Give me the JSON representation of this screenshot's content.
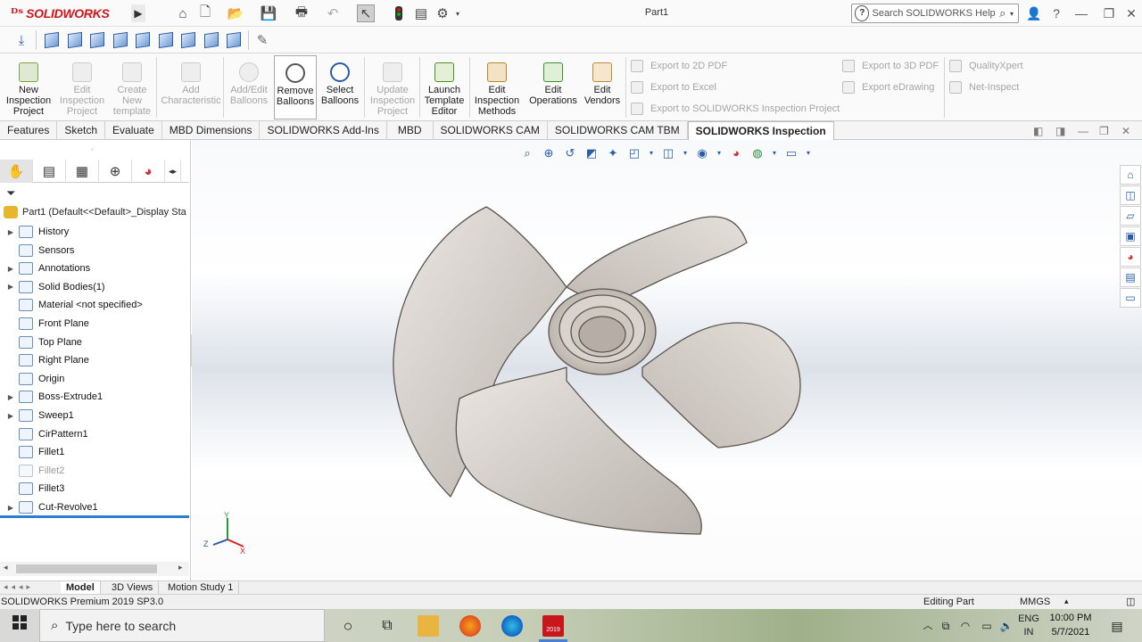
{
  "app": {
    "logo_text": "SOLIDWORKS",
    "doc_title": "Part1",
    "search_placeholder": "Search SOLIDWORKS Help"
  },
  "command_manager": {
    "buttons": [
      {
        "label": "New\nInspection\nProject",
        "enabled": true
      },
      {
        "label": "Edit\nInspection\nProject",
        "enabled": false
      },
      {
        "label": "Create\nNew\ntemplate",
        "enabled": false
      },
      {
        "label": "Add\nCharacteristic",
        "enabled": false
      },
      {
        "label": "Add/Edit\nBalloons",
        "enabled": false
      },
      {
        "label": "Remove\nBalloons",
        "enabled": true
      },
      {
        "label": "Select\nBalloons",
        "enabled": true
      },
      {
        "label": "Update\nInspection\nProject",
        "enabled": false
      },
      {
        "label": "Launch\nTemplate\nEditor",
        "enabled": true
      },
      {
        "label": "Edit\nInspection\nMethods",
        "enabled": true
      },
      {
        "label": "Edit\nOperations",
        "enabled": true
      },
      {
        "label": "Edit\nVendors",
        "enabled": true
      }
    ],
    "export": {
      "export_2d_pdf": "Export to 2D PDF",
      "export_excel": "Export to Excel",
      "export_sw_project": "Export to SOLIDWORKS Inspection Project",
      "export_3d_pdf": "Export to 3D PDF",
      "export_edrawing": "Export eDrawing",
      "qualityxpert": "QualityXpert",
      "net_inspect": "Net-Inspect"
    }
  },
  "tabs": [
    "Features",
    "Sketch",
    "Evaluate",
    "MBD Dimensions",
    "SOLIDWORKS Add-Ins",
    "MBD",
    "SOLIDWORKS CAM",
    "SOLIDWORKS CAM TBM",
    "SOLIDWORKS Inspection"
  ],
  "selected_tab": "SOLIDWORKS Inspection",
  "feature_tree": {
    "root": "Part1  (Default<<Default>_Display Sta",
    "items": [
      {
        "label": "History",
        "expandable": true,
        "suppressed": false
      },
      {
        "label": "Sensors",
        "expandable": false,
        "suppressed": false
      },
      {
        "label": "Annotations",
        "expandable": true,
        "suppressed": false
      },
      {
        "label": "Solid Bodies(1)",
        "expandable": true,
        "suppressed": false
      },
      {
        "label": "Material <not specified>",
        "expandable": false,
        "suppressed": false
      },
      {
        "label": "Front Plane",
        "expandable": false,
        "suppressed": false
      },
      {
        "label": "Top Plane",
        "expandable": false,
        "suppressed": false
      },
      {
        "label": "Right Plane",
        "expandable": false,
        "suppressed": false
      },
      {
        "label": "Origin",
        "expandable": false,
        "suppressed": false
      },
      {
        "label": "Boss-Extrude1",
        "expandable": true,
        "suppressed": false
      },
      {
        "label": "Sweep1",
        "expandable": true,
        "suppressed": false
      },
      {
        "label": "CirPattern1",
        "expandable": false,
        "suppressed": false
      },
      {
        "label": "Fillet1",
        "expandable": false,
        "suppressed": false
      },
      {
        "label": "Fillet2",
        "expandable": false,
        "suppressed": true
      },
      {
        "label": "Fillet3",
        "expandable": false,
        "suppressed": false
      },
      {
        "label": "Cut-Revolve1",
        "expandable": true,
        "suppressed": false
      }
    ]
  },
  "triad": {
    "y": "Y",
    "z": "Z",
    "x": "X"
  },
  "bottom_tabs": [
    "Model",
    "3D Views",
    "Motion Study 1"
  ],
  "selected_bottom_tab": "Model",
  "status": {
    "version": "SOLIDWORKS Premium 2019 SP3.0",
    "mode": "Editing Part",
    "units": "MMGS"
  },
  "taskbar": {
    "search_placeholder": "Type here to search",
    "language": "ENG",
    "region": "IN",
    "time": "10:00 PM",
    "date": "5/7/2021",
    "sw_badge": "2019"
  },
  "colors": {
    "accent": "#2d7dd2",
    "brand": "#d1131a",
    "part": "#d8d2cc"
  }
}
